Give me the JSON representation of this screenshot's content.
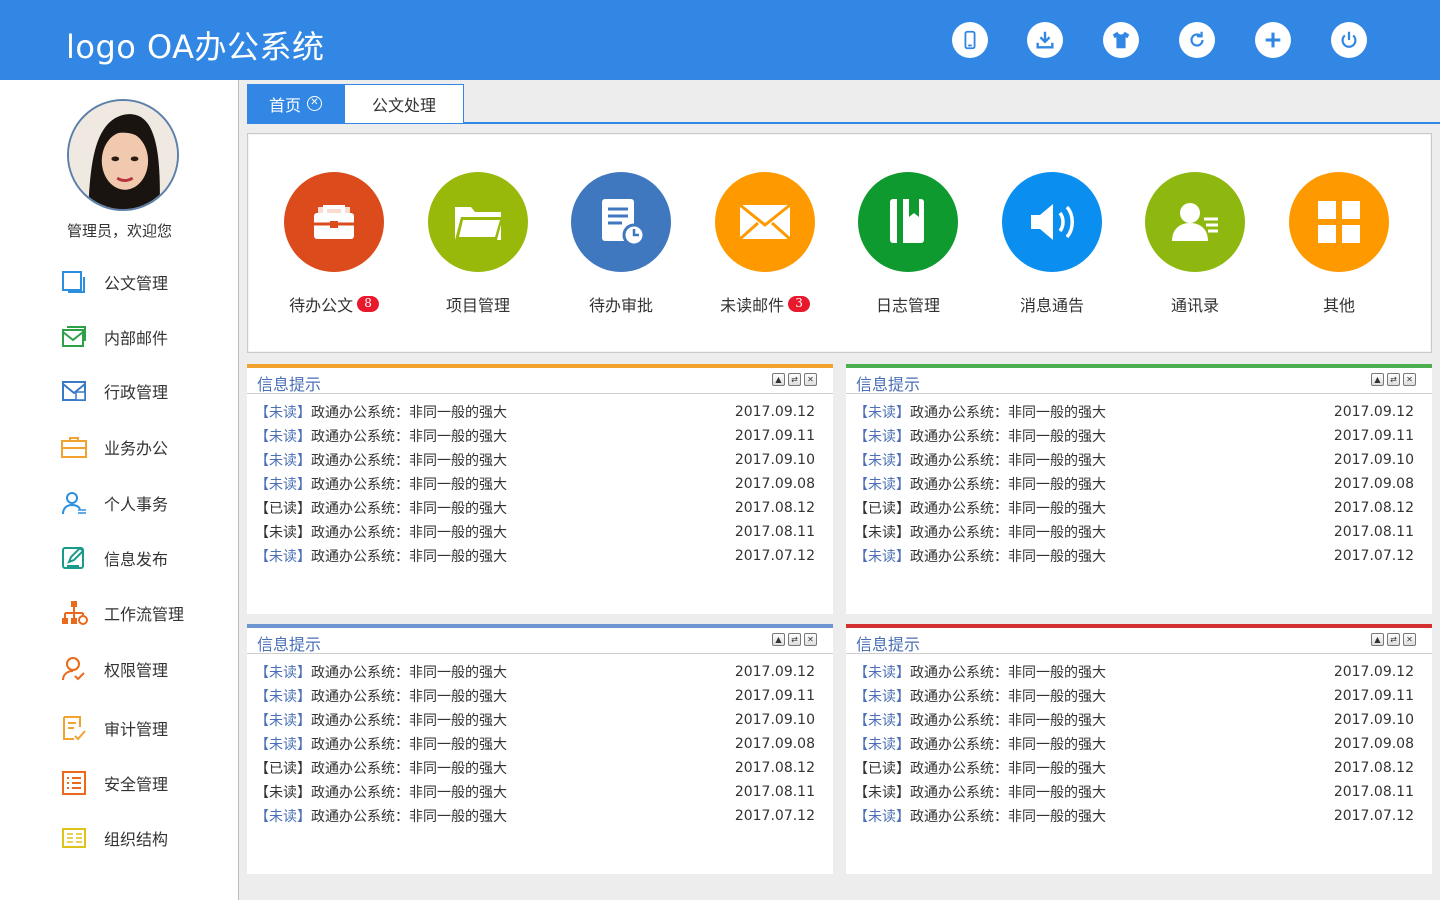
{
  "header": {
    "logo": "logo OA办公系统",
    "icons": [
      "phone-icon",
      "download-icon",
      "tshirt-icon",
      "refresh-icon",
      "plus-icon",
      "power-icon"
    ]
  },
  "sidebar": {
    "welcome": "管理员，欢迎您",
    "items": [
      {
        "label": "公文管理",
        "icon": "document-icon"
      },
      {
        "label": "内部邮件",
        "icon": "mail-icon"
      },
      {
        "label": "行政管理",
        "icon": "admin-mail-icon"
      },
      {
        "label": "业务办公",
        "icon": "briefcase-icon"
      },
      {
        "label": "个人事务",
        "icon": "user-icon"
      },
      {
        "label": "信息发布",
        "icon": "edit-icon"
      },
      {
        "label": "工作流管理",
        "icon": "workflow-icon"
      },
      {
        "label": "权限管理",
        "icon": "permission-icon"
      },
      {
        "label": "审计管理",
        "icon": "audit-icon"
      },
      {
        "label": "安全管理",
        "icon": "security-list-icon"
      },
      {
        "label": "组织结构",
        "icon": "organization-icon"
      }
    ]
  },
  "tabs": {
    "home": "首页",
    "doc": "公文处理"
  },
  "quick": [
    {
      "label": "待办公文",
      "badge": "8",
      "color": "#dc4b1b"
    },
    {
      "label": "项目管理",
      "badge": "",
      "color": "#98b90a"
    },
    {
      "label": "待办审批",
      "badge": "",
      "color": "#4078c0"
    },
    {
      "label": "未读邮件",
      "badge": "3",
      "color": "#ff9900"
    },
    {
      "label": "日志管理",
      "badge": "",
      "color": "#0f9a2f"
    },
    {
      "label": "消息通告",
      "badge": "",
      "color": "#0a8ef0"
    },
    {
      "label": "通讯录",
      "badge": "",
      "color": "#8eb810"
    },
    {
      "label": "其他",
      "badge": "",
      "color": "#ff9900"
    }
  ],
  "panels": [
    {
      "title": "信息提示",
      "color": "#f2a32f",
      "rows": [
        {
          "status": "【未读】",
          "text": "政通办公系统：非同一般的强大",
          "date": "2017.09.12",
          "read": false
        },
        {
          "status": "【未读】",
          "text": "政通办公系统：非同一般的强大",
          "date": "2017.09.11",
          "read": false
        },
        {
          "status": "【未读】",
          "text": "政通办公系统：非同一般的强大",
          "date": "2017.09.10",
          "read": false
        },
        {
          "status": "【未读】",
          "text": "政通办公系统：非同一般的强大",
          "date": "2017.09.08",
          "read": false
        },
        {
          "status": "【已读】",
          "text": "政通办公系统：非同一般的强大",
          "date": "2017.08.12",
          "read": true
        },
        {
          "status": "【未读】",
          "text": "政通办公系统：非同一般的强大",
          "date": "2017.08.11",
          "read": true
        },
        {
          "status": "【未读】",
          "text": "政通办公系统：非同一般的强大",
          "date": "2017.07.12",
          "read": false
        }
      ]
    },
    {
      "title": "信息提示",
      "color": "#4caf50",
      "rows": [
        {
          "status": "【未读】",
          "text": "政通办公系统：非同一般的强大",
          "date": "2017.09.12",
          "read": false
        },
        {
          "status": "【未读】",
          "text": "政通办公系统：非同一般的强大",
          "date": "2017.09.11",
          "read": false
        },
        {
          "status": "【未读】",
          "text": "政通办公系统：非同一般的强大",
          "date": "2017.09.10",
          "read": false
        },
        {
          "status": "【未读】",
          "text": "政通办公系统：非同一般的强大",
          "date": "2017.09.08",
          "read": false
        },
        {
          "status": "【已读】",
          "text": "政通办公系统：非同一般的强大",
          "date": "2017.08.12",
          "read": true
        },
        {
          "status": "【未读】",
          "text": "政通办公系统：非同一般的强大",
          "date": "2017.08.11",
          "read": true
        },
        {
          "status": "【未读】",
          "text": "政通办公系统：非同一般的强大",
          "date": "2017.07.12",
          "read": false
        }
      ]
    },
    {
      "title": "信息提示",
      "color": "#6d95cf",
      "rows": [
        {
          "status": "【未读】",
          "text": "政通办公系统：非同一般的强大",
          "date": "2017.09.12",
          "read": false
        },
        {
          "status": "【未读】",
          "text": "政通办公系统：非同一般的强大",
          "date": "2017.09.11",
          "read": false
        },
        {
          "status": "【未读】",
          "text": "政通办公系统：非同一般的强大",
          "date": "2017.09.10",
          "read": false
        },
        {
          "status": "【未读】",
          "text": "政通办公系统：非同一般的强大",
          "date": "2017.09.08",
          "read": false
        },
        {
          "status": "【已读】",
          "text": "政通办公系统：非同一般的强大",
          "date": "2017.08.12",
          "read": true
        },
        {
          "status": "【未读】",
          "text": "政通办公系统：非同一般的强大",
          "date": "2017.08.11",
          "read": true
        },
        {
          "status": "【未读】",
          "text": "政通办公系统：非同一般的强大",
          "date": "2017.07.12",
          "read": false
        }
      ]
    },
    {
      "title": "信息提示",
      "color": "#d32f2f",
      "rows": [
        {
          "status": "【未读】",
          "text": "政通办公系统：非同一般的强大",
          "date": "2017.09.12",
          "read": false
        },
        {
          "status": "【未读】",
          "text": "政通办公系统：非同一般的强大",
          "date": "2017.09.11",
          "read": false
        },
        {
          "status": "【未读】",
          "text": "政通办公系统：非同一般的强大",
          "date": "2017.09.10",
          "read": false
        },
        {
          "status": "【未读】",
          "text": "政通办公系统：非同一般的强大",
          "date": "2017.09.08",
          "read": false
        },
        {
          "status": "【已读】",
          "text": "政通办公系统：非同一般的强大",
          "date": "2017.08.12",
          "read": true
        },
        {
          "status": "【未读】",
          "text": "政通办公系统：非同一般的强大",
          "date": "2017.08.11",
          "read": true
        },
        {
          "status": "【未读】",
          "text": "政通办公系统：非同一般的强大",
          "date": "2017.07.12",
          "read": false
        }
      ]
    }
  ]
}
